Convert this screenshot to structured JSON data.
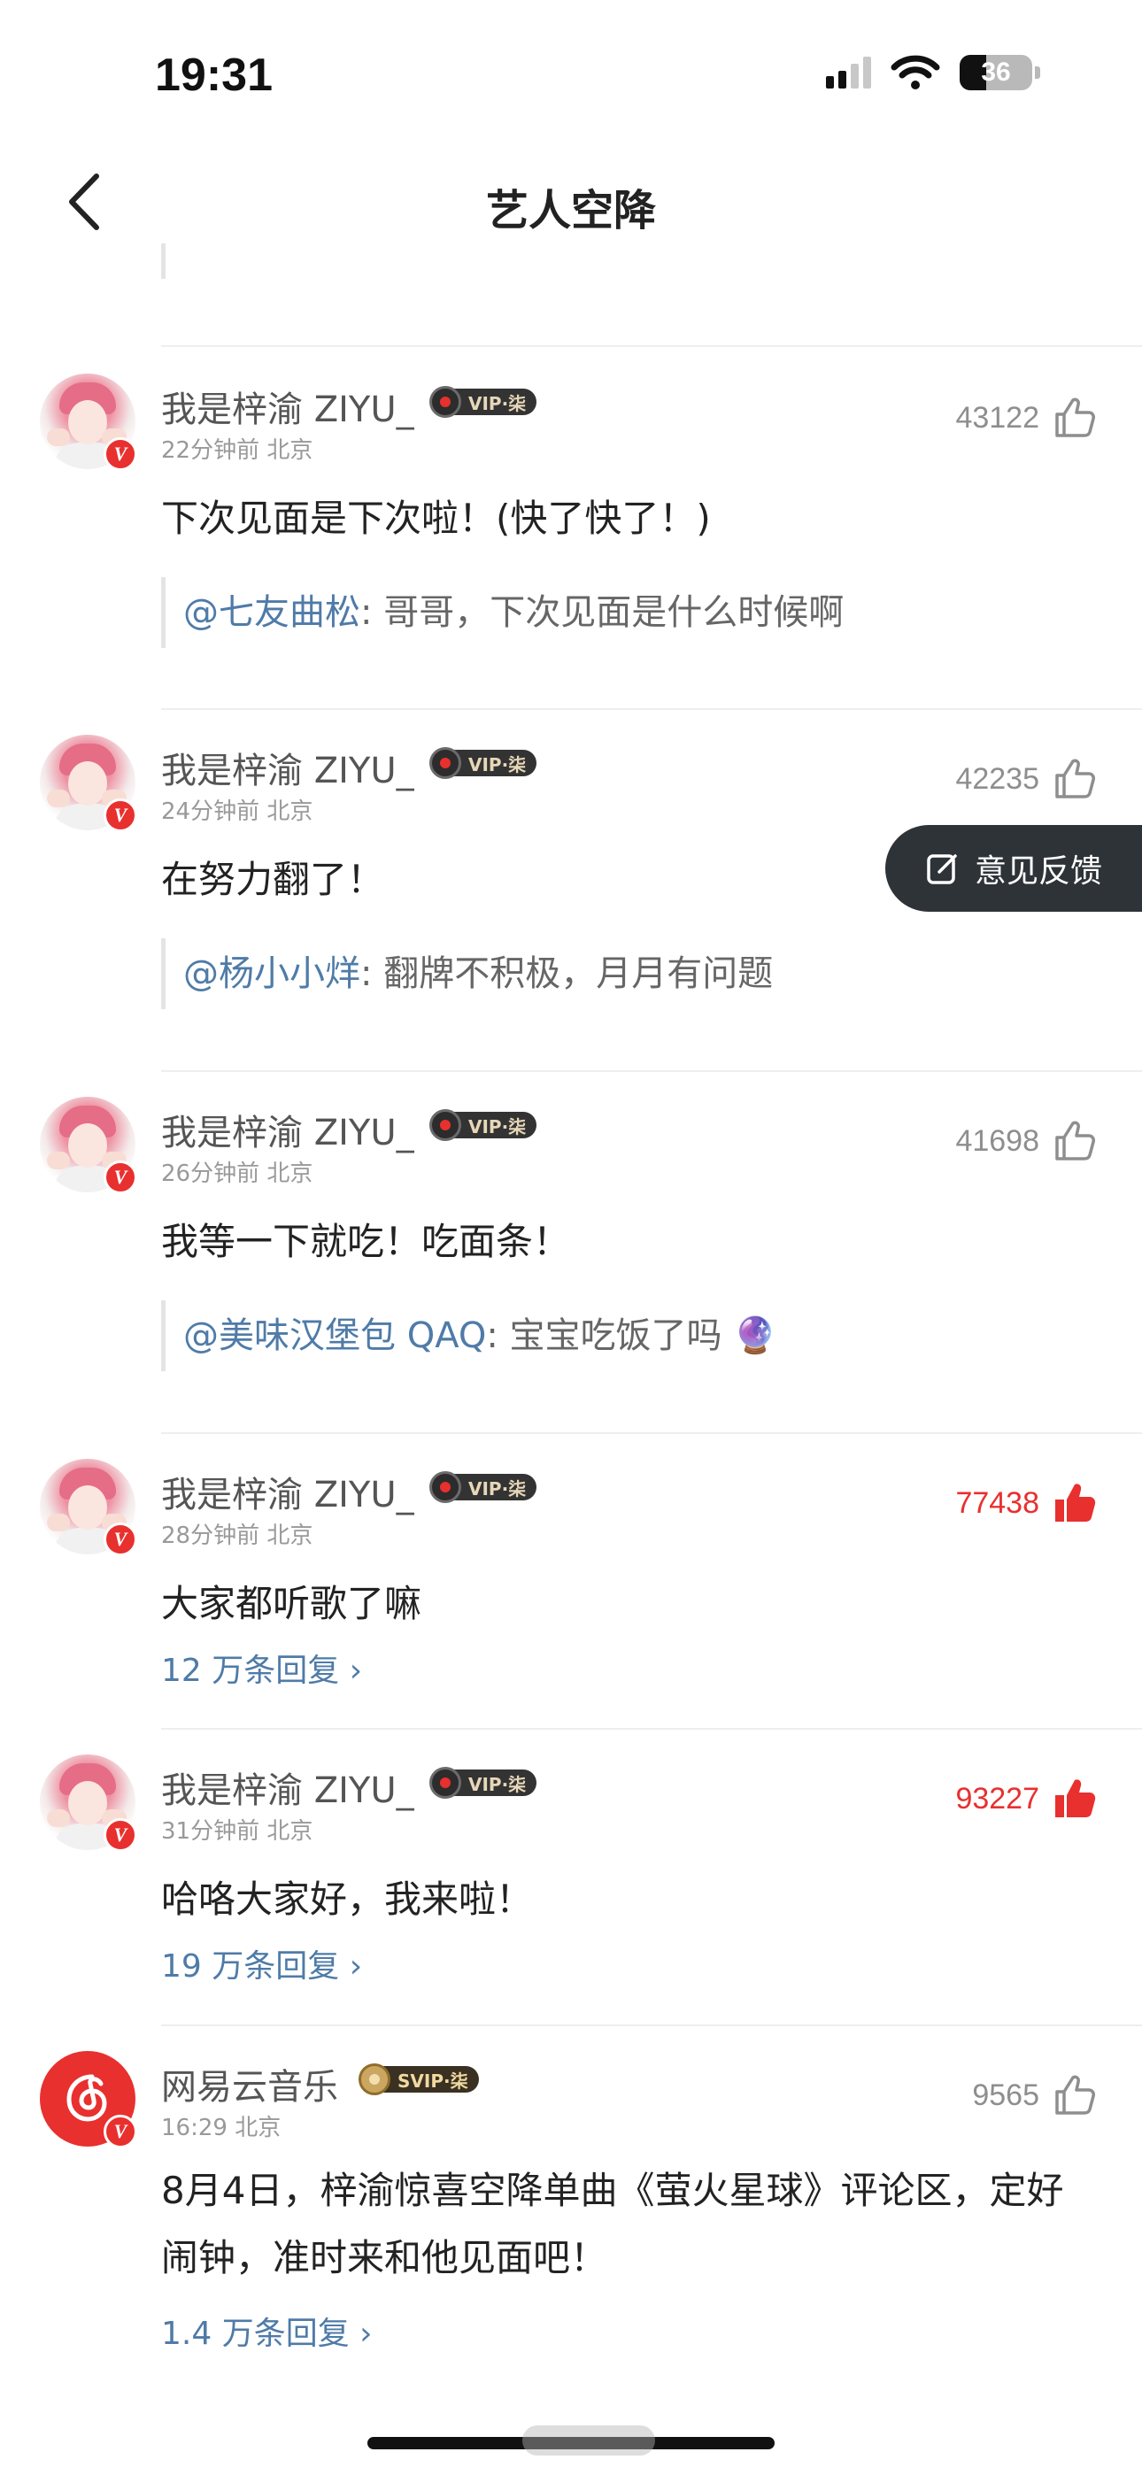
{
  "status_bar": {
    "time": "19:31",
    "battery": "36"
  },
  "nav": {
    "title": "艺人空降"
  },
  "feedback": {
    "label": "意见反馈"
  },
  "comments": [
    {
      "username": "我是梓渝 ZIYU_",
      "vip": "VIP·柒",
      "meta": "22分钟前 北京",
      "likes": "43122",
      "liked": false,
      "content": "下次见面是下次啦！(快了快了！)",
      "quote_user": "@七友曲松",
      "quote_text": ": 哥哥，下次见面是什么时候啊"
    },
    {
      "username": "我是梓渝 ZIYU_",
      "vip": "VIP·柒",
      "meta": "24分钟前 北京",
      "likes": "42235",
      "liked": false,
      "content": "在努力翻了！",
      "quote_user": "@杨小小烊",
      "quote_text": ": 翻牌不积极，月月有问题"
    },
    {
      "username": "我是梓渝 ZIYU_",
      "vip": "VIP·柒",
      "meta": "26分钟前 北京",
      "likes": "41698",
      "liked": false,
      "content": "我等一下就吃！吃面条！",
      "quote_user": "@美味汉堡包 QAQ",
      "quote_text": ": 宝宝吃饭了吗 🔮"
    },
    {
      "username": "我是梓渝 ZIYU_",
      "vip": "VIP·柒",
      "meta": "28分钟前 北京",
      "likes": "77438",
      "liked": true,
      "content": "大家都听歌了嘛",
      "replies": "12 万条回复 ›"
    },
    {
      "username": "我是梓渝 ZIYU_",
      "vip": "VIP·柒",
      "meta": "31分钟前 北京",
      "likes": "93227",
      "liked": true,
      "content": "哈咯大家好，我来啦！",
      "replies": "19 万条回复 ›"
    },
    {
      "username": "网易云音乐",
      "vip": "SVIP·柒",
      "meta": "16:29 北京",
      "likes": "9565",
      "liked": false,
      "content": "8月4日，梓渝惊喜空降单曲《萤火星球》评论区，定好闹钟，准时来和他见面吧！",
      "replies": "1.4 万条回复 ›"
    }
  ],
  "colors": {
    "accent_red": "#e8302f",
    "link_blue": "#4f7ba8"
  }
}
